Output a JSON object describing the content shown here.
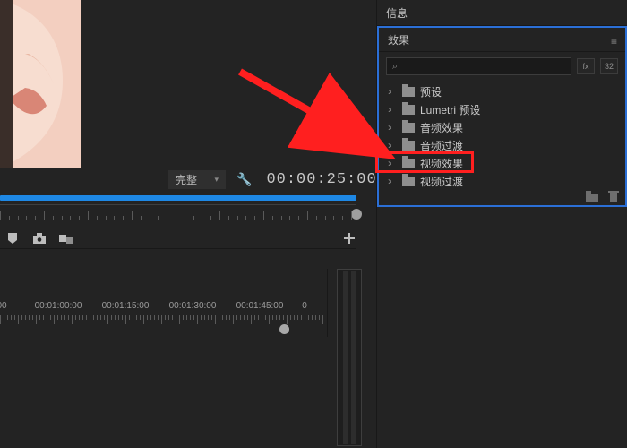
{
  "panels": {
    "info": {
      "title": "信息"
    },
    "effects": {
      "title": "效果",
      "search_placeholder": "",
      "toggles": {
        "a": "fx",
        "b": "32"
      }
    }
  },
  "effects_tree": {
    "items": [
      {
        "label": "预设"
      },
      {
        "label": "Lumetri 预设"
      },
      {
        "label": "音频效果"
      },
      {
        "label": "音频过渡"
      },
      {
        "label": "视频效果"
      },
      {
        "label": "视频过渡"
      }
    ]
  },
  "preview": {
    "quality_label": "完整",
    "timecode": "00:00:25:00"
  },
  "mini_timeline": {
    "marks": [
      {
        "label": "00",
        "pos": 2
      },
      {
        "label": "00:01:00:00",
        "pos": 65
      },
      {
        "label": "00:01:15:00",
        "pos": 140
      },
      {
        "label": "00:01:30:00",
        "pos": 215
      },
      {
        "label": "00:01:45:00",
        "pos": 290
      },
      {
        "label": "0",
        "pos": 340
      }
    ]
  },
  "colors": {
    "accent_blue": "#2b6fd6",
    "annotation_red": "#ff1f1f",
    "scrub_blue": "#1e88e5"
  },
  "annotation": {
    "target_item_index": 4
  }
}
